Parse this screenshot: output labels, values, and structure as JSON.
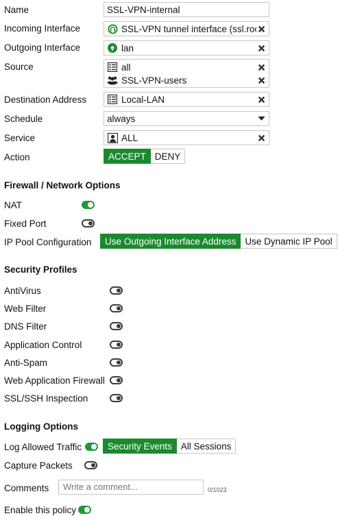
{
  "labels": {
    "name": "Name",
    "incoming": "Incoming Interface",
    "outgoing": "Outgoing Interface",
    "source": "Source",
    "destination": "Destination Address",
    "schedule": "Schedule",
    "service": "Service",
    "action": "Action"
  },
  "fields": {
    "name_value": "SSL-VPN-internal",
    "incoming_value": "SSL-VPN tunnel interface (ssl.root)",
    "outgoing_value": "lan",
    "source_values": [
      "all",
      "SSL-VPN-users"
    ],
    "destination_value": "Local-LAN",
    "schedule_value": "always",
    "service_value": "ALL"
  },
  "action": {
    "accept": "ACCEPT",
    "deny": "DENY",
    "selected": "ACCEPT"
  },
  "firewall": {
    "title": "Firewall / Network Options",
    "nat_label": "NAT",
    "nat_on": true,
    "fixed_port_label": "Fixed Port",
    "fixed_port_on": false,
    "ip_pool_label": "IP Pool Configuration",
    "ip_pool_options": [
      "Use Outgoing Interface Address",
      "Use Dynamic IP Pool"
    ],
    "ip_pool_selected": "Use Outgoing Interface Address"
  },
  "security": {
    "title": "Security Profiles",
    "items": [
      {
        "label": "AntiVirus",
        "on": false
      },
      {
        "label": "Web Filter",
        "on": false
      },
      {
        "label": "DNS Filter",
        "on": false
      },
      {
        "label": "Application Control",
        "on": false
      },
      {
        "label": "Anti-Spam",
        "on": false
      },
      {
        "label": "Web Application Firewall",
        "on": false
      },
      {
        "label": "SSL/SSH Inspection",
        "on": false
      }
    ]
  },
  "logging": {
    "title": "Logging Options",
    "log_allowed_label": "Log Allowed Traffic",
    "log_allowed_on": true,
    "log_options": [
      "Security Events",
      "All Sessions"
    ],
    "log_selected": "Security Events",
    "capture_label": "Capture Packets",
    "capture_on": false
  },
  "comments": {
    "label": "Comments",
    "placeholder": "Write a comment...",
    "counter": "0/1023"
  },
  "enable": {
    "label": "Enable this policy",
    "on": true
  },
  "colors": {
    "accent": "#1b8a2e",
    "toggle_on": "#1f9a3a",
    "border": "#c6c6c6"
  },
  "icons": {
    "incoming": "tunnel-interface-icon",
    "outgoing": "interface-up-arrow-icon",
    "source_all": "address-list-icon",
    "source_users": "user-group-icon",
    "destination": "address-list-icon",
    "service": "service-icon",
    "remove": "close-icon",
    "schedule": "chevron-down-icon"
  }
}
